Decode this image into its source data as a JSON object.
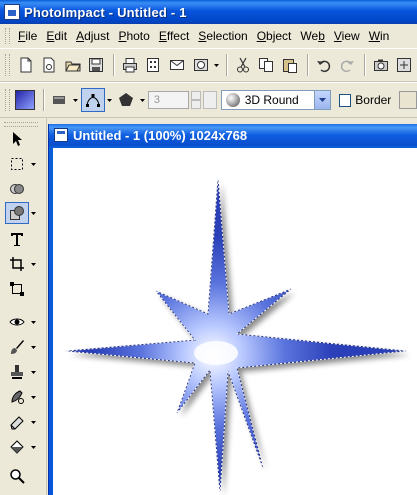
{
  "app": {
    "title": "PhotoImpact - Untitled - 1"
  },
  "menu": {
    "items": [
      {
        "label": "File",
        "u": "F",
        "rest": "ile"
      },
      {
        "label": "Edit",
        "u": "E",
        "rest": "dit"
      },
      {
        "label": "Adjust",
        "u": "A",
        "rest": "djust"
      },
      {
        "label": "Photo",
        "u": "P",
        "rest": "hoto"
      },
      {
        "label": "Effect",
        "u": "E",
        "rest": "ffect"
      },
      {
        "label": "Selection",
        "u": "S",
        "rest": "election"
      },
      {
        "label": "Object",
        "u": "O",
        "rest": "bject"
      },
      {
        "label": "Web",
        "pre": "We",
        "u": "b",
        "rest": ""
      },
      {
        "label": "View",
        "u": "V",
        "rest": "iew"
      },
      {
        "label": "Window",
        "u": "W",
        "rest": "in"
      }
    ]
  },
  "toolbar": {
    "icons": [
      "new-icon",
      "new-from-template-icon",
      "open-icon",
      "save-icon",
      "print-icon",
      "scan-icon",
      "email-icon",
      "capture-icon",
      "cut-icon",
      "copy-icon",
      "paste-icon",
      "undo-icon",
      "redo-icon",
      "camera-icon",
      "options-icon"
    ]
  },
  "attributes": {
    "line_width_value": "3",
    "style_value": "3D Round",
    "border_label": "Border",
    "fill_color": "#4a5fd4"
  },
  "document": {
    "title": "Untitled - 1 (100%) 1024x768"
  },
  "colors": {
    "titlebar": "#0855dd",
    "star_dark": "#2a3fb8",
    "star_light": "#ffffff"
  }
}
